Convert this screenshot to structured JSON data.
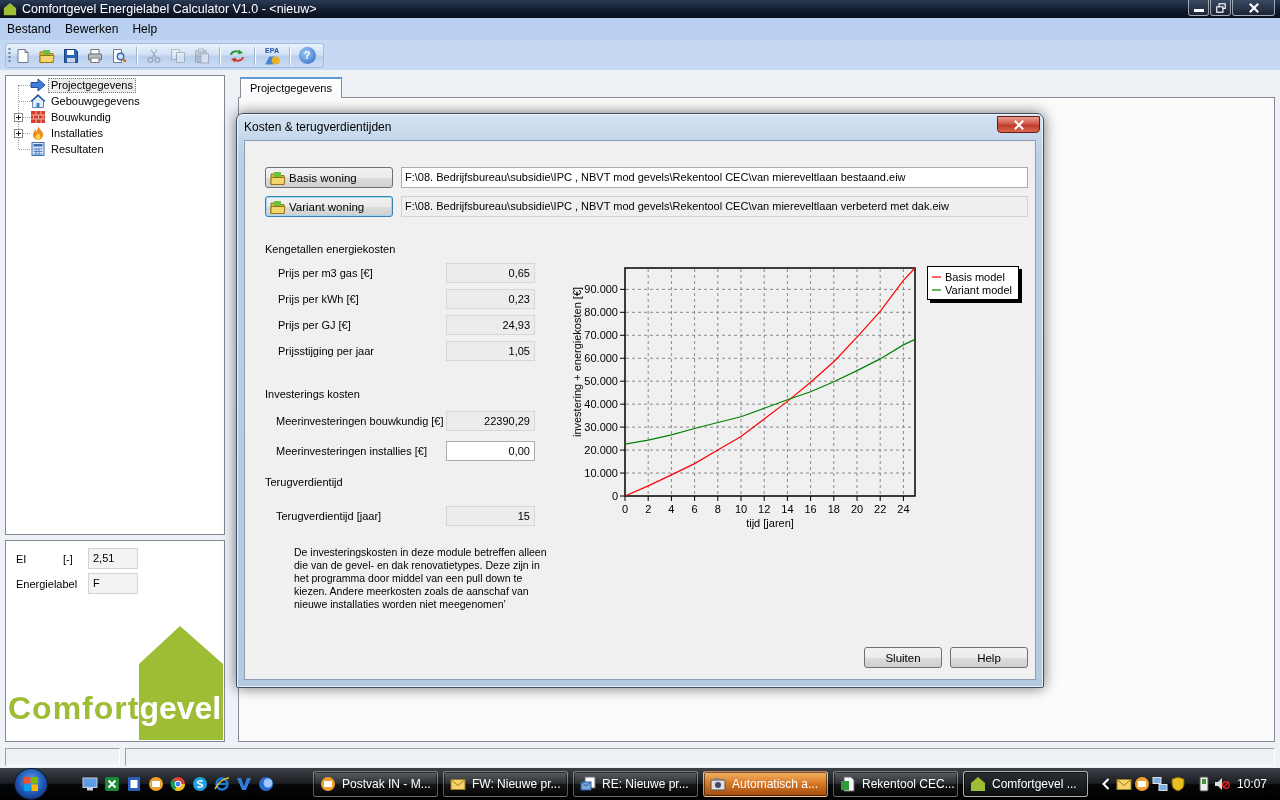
{
  "window": {
    "title": "Comfortgevel Energielabel Calculator V1.0 - <nieuw>"
  },
  "menu": [
    {
      "label": "Bestand"
    },
    {
      "label": "Bewerken"
    },
    {
      "label": "Help"
    }
  ],
  "toolbar": [
    {
      "kind": "button",
      "disabled": false
    },
    {
      "kind": "button",
      "disabled": false
    },
    {
      "kind": "button",
      "disabled": false
    },
    {
      "kind": "button",
      "disabled": false
    },
    {
      "kind": "button",
      "disabled": false
    },
    {
      "kind": "separator"
    },
    {
      "kind": "button",
      "disabled": true
    },
    {
      "kind": "button",
      "disabled": true
    },
    {
      "kind": "button",
      "disabled": true
    },
    {
      "kind": "separator"
    },
    {
      "kind": "button",
      "disabled": false
    },
    {
      "kind": "separator"
    },
    {
      "kind": "labelled",
      "disabled": false,
      "label": "EPA"
    },
    {
      "kind": "separator"
    },
    {
      "kind": "help",
      "disabled": false,
      "label": "?"
    }
  ],
  "tree": {
    "items": [
      {
        "label": "Projectgegevens",
        "kind": "item",
        "selected": true
      },
      {
        "label": "Gebouwgegevens",
        "kind": "item",
        "selected": false
      },
      {
        "label": "Bouwkundig",
        "kind": "group",
        "expanded": false,
        "selected": false
      },
      {
        "label": "Installaties",
        "kind": "group",
        "expanded": false,
        "selected": false
      },
      {
        "label": "Resultaten",
        "kind": "item",
        "selected": false
      }
    ]
  },
  "summary": [
    {
      "label": "EI",
      "unit": "[-]",
      "value": "2,51"
    },
    {
      "label": "Energielabel",
      "value": "F"
    }
  ],
  "logo": [
    {
      "text": "Comfort",
      "color": "#9dbd35"
    },
    {
      "text": "gevel",
      "color": "#ffffff"
    }
  ],
  "tabs": [
    {
      "label": "Projectgegevens",
      "selected": true
    }
  ],
  "dialog": {
    "title": "Kosten & terugverdientijden",
    "files": [
      {
        "button": "Basis woning",
        "focused": false,
        "path": "F:\\08. Bedrijfsbureau\\subsidie\\IPC , NBVT mod gevels\\Rekentool CEC\\van miereveltlaan bestaand.eiw",
        "readonly": false
      },
      {
        "button": "Variant woning",
        "focused": true,
        "path": "F:\\08. Bedrijfsbureau\\subsidie\\IPC , NBVT mod gevels\\Rekentool CEC\\van miereveltlaan verbeterd met dak.eiw",
        "readonly": true
      }
    ],
    "sections": [
      {
        "title": "Kengetallen energiekosten",
        "fields": [
          {
            "label": "Prijs per m3 gas [€]",
            "value": "0,65",
            "readonly": true
          },
          {
            "label": "Prijs per kWh [€]",
            "value": "0,23",
            "readonly": true
          },
          {
            "label": "Prijs per GJ [€]",
            "value": "24,93",
            "readonly": true
          },
          {
            "label": "Prijsstijging per jaar",
            "value": "1,05",
            "readonly": true
          }
        ]
      },
      {
        "title": "Investerings kosten",
        "fields": [
          {
            "label": "Meerinvesteringen bouwkundig [€]",
            "value": "22390,29",
            "readonly": true
          },
          {
            "label": "Meerinvesteringen installies [€]",
            "value": "0,00",
            "readonly": false
          }
        ]
      },
      {
        "title": "Terugverdientijd",
        "fields": [
          {
            "label": "Terugverdientijd [jaar]",
            "value": "15",
            "readonly": true
          }
        ]
      }
    ],
    "note": "De investeringskosten in deze module betreffen alleen die van de gevel- en dak renovatietypes. Deze zijn in het programma door middel van een pull down te kiezen. Andere meerkosten zoals de aanschaf van nieuwe installaties worden niet meegenomen’",
    "chart": {
      "chart_data": {
        "type": "line",
        "xlabel": "tijd [jaren]",
        "ylabel": "investering + energiekosten [€]",
        "x": [
          0,
          2,
          4,
          6,
          8,
          10,
          12,
          14,
          16,
          18,
          20,
          22,
          24,
          25
        ],
        "series": [
          {
            "name": "Basis model",
            "color": "#ff0000",
            "values": [
              0,
              4400,
              9200,
              14100,
              20000,
              25900,
              33500,
              41200,
              49500,
              58500,
              69200,
              80400,
              93900,
              99300
            ]
          },
          {
            "name": "Variant model",
            "color": "#008000",
            "values": [
              22600,
              24300,
              26600,
              29400,
              32000,
              34500,
              38200,
              41900,
              45400,
              49800,
              54600,
              59700,
              65800,
              68200
            ]
          }
        ],
        "xlim": [
          0,
          25
        ],
        "ylim": [
          0,
          99300
        ],
        "xticks": [
          0,
          2,
          4,
          6,
          8,
          10,
          12,
          14,
          16,
          18,
          20,
          22,
          24
        ],
        "yticks": [
          {
            "value": 0,
            "label": "0"
          },
          {
            "value": 10000,
            "label": "10.000"
          },
          {
            "value": 20000,
            "label": "20.000"
          },
          {
            "value": 30000,
            "label": "30.000"
          },
          {
            "value": 40000,
            "label": "40.000"
          },
          {
            "value": 50000,
            "label": "50.000"
          },
          {
            "value": 60000,
            "label": "60.000"
          },
          {
            "value": 70000,
            "label": "70.000"
          },
          {
            "value": 80000,
            "label": "80.000"
          },
          {
            "value": 90000,
            "label": "90.000"
          }
        ],
        "grid": true,
        "legend": true
      }
    },
    "buttons": [
      {
        "label": "Sluiten"
      },
      {
        "label": "Help"
      }
    ]
  },
  "taskbar": {
    "buttons": [
      {
        "label": "Postvak IN - M...",
        "selected": false,
        "flashing": false
      },
      {
        "label": "FW: Nieuwe pr...",
        "selected": false,
        "flashing": false
      },
      {
        "label": "RE: Nieuwe pr...",
        "selected": false,
        "flashing": false
      },
      {
        "label": "Automatisch a...",
        "selected": false,
        "flashing": true
      },
      {
        "label": "Rekentool CEC...",
        "selected": false,
        "flashing": false
      },
      {
        "label": "Comfortgevel ...",
        "selected": true,
        "flashing": false
      }
    ],
    "clock": "10:07"
  }
}
